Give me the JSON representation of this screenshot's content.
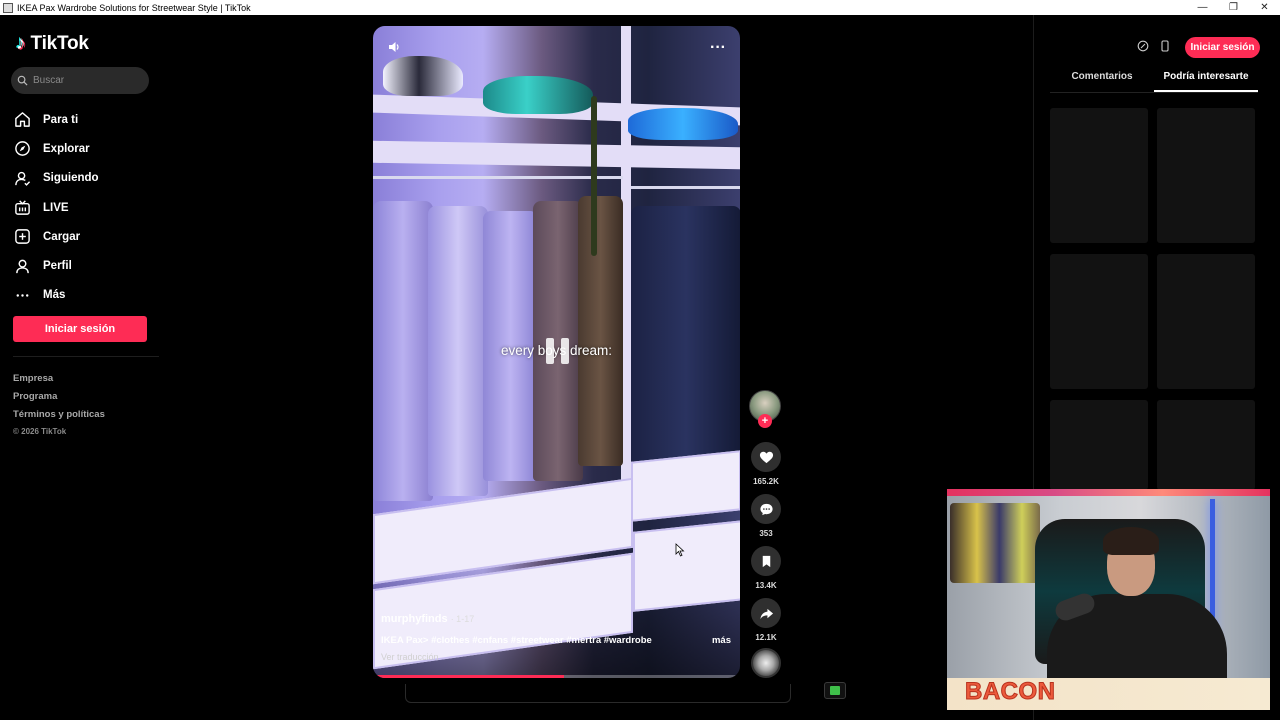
{
  "window": {
    "title": "IKEA Pax Wardrobe Solutions for Streetwear Style | TikTok",
    "controls": [
      "—",
      "❐",
      "✕"
    ]
  },
  "sidebar": {
    "logo_text": "TikTok",
    "search_placeholder": "Buscar",
    "items": [
      {
        "label": "Para ti",
        "icon": "home-icon"
      },
      {
        "label": "Explorar",
        "icon": "compass-icon"
      },
      {
        "label": "Siguiendo",
        "icon": "following-icon"
      },
      {
        "label": "LIVE",
        "icon": "live-icon"
      },
      {
        "label": "Cargar",
        "icon": "upload-icon"
      },
      {
        "label": "Perfil",
        "icon": "profile-icon"
      },
      {
        "label": "Más",
        "icon": "more-icon"
      }
    ],
    "login_label": "Iniciar sesión",
    "footer": [
      "Empresa",
      "Programa",
      "Términos y políticas"
    ],
    "copyright": "© 2026 TikTok"
  },
  "video": {
    "caption_overlay": "every boys dream:",
    "author": "murphyfinds",
    "date": "· 1-17",
    "description": "IKEA Pax> #clothes #cnfans #streetwear #mertra #wardrobe",
    "more_label": "más",
    "translate_label": "Ver traducción",
    "progress": 0.52,
    "more_options": "···"
  },
  "actions": {
    "likes": "165.2K",
    "comments": "353",
    "saves": "13.4K",
    "shares": "12.1K",
    "follow_symbol": "+"
  },
  "right_panel": {
    "login_label": "Iniciar sesión",
    "tabs": [
      {
        "label": "Comentarios",
        "active": false
      },
      {
        "label": "Podría interesarte",
        "active": true
      }
    ]
  },
  "webcam": {
    "label": "BACON"
  },
  "colors": {
    "brand": "#fe2c55",
    "background": "#000000"
  }
}
